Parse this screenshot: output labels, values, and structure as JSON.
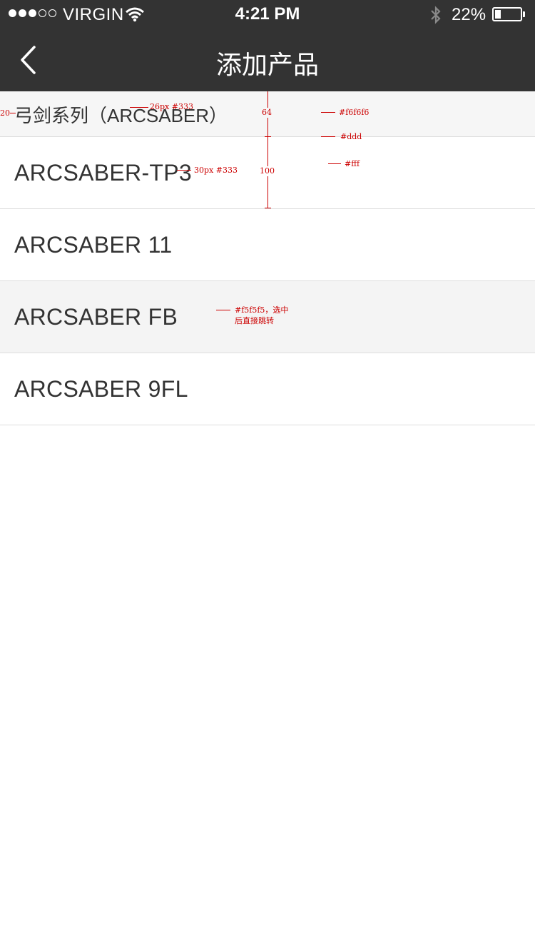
{
  "status_bar": {
    "carrier": "VIRGIN",
    "time": "4:21 PM",
    "battery": "22%",
    "battery_level": 0.22,
    "signal_strength": 3,
    "signal_max": 5
  },
  "nav": {
    "title": "添加产品"
  },
  "section": {
    "title": "弓剑系列（ARCSABER）"
  },
  "items": [
    {
      "label": "ARCSABER-TP3"
    },
    {
      "label": "ARCSABER 11"
    },
    {
      "label": "ARCSABER FB",
      "selected": true
    },
    {
      "label": "ARCSABER 9FL"
    }
  ],
  "annotations": {
    "padding": "20",
    "header_font": "26px  #333",
    "header_height": "64",
    "header_bg": "#f6f6f6",
    "divider": "#ddd",
    "item_height": "100",
    "item_font": "30px  #333",
    "item_bg": "#fff",
    "selected_note_1": "#f5f5f5，选中",
    "selected_note_2": "后直接跳转"
  },
  "colors": {
    "bar_bg": "#333333",
    "header_bg": "#f6f6f6",
    "divider": "#dddddd",
    "selected_bg": "#f4f4f4",
    "text": "#333333",
    "annotation": "#cc0000"
  }
}
